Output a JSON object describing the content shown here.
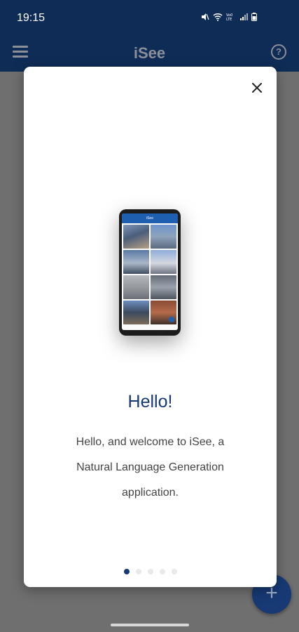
{
  "status_bar": {
    "time": "19:15",
    "icons": [
      "mute-icon",
      "wifi-icon",
      "volte-icon",
      "signal-icon",
      "battery-icon"
    ]
  },
  "app_bar": {
    "title": "iSee",
    "menu_icon": "menu-icon",
    "help_icon": "help-icon",
    "help_glyph": "?"
  },
  "fab": {
    "icon": "plus-icon",
    "glyph": "+"
  },
  "dialog": {
    "heading": "Hello!",
    "body": "Hello, and welcome to iSee, a Natural Language Generation application.",
    "close_icon": "close-icon",
    "pages": 5,
    "active_page": 1,
    "illustration": {
      "phone_title": "iSee"
    }
  },
  "colors": {
    "primary": "#173a74",
    "status_bar": "#0f2c57",
    "scrim": "#6f6f6f",
    "text": "#444444"
  }
}
